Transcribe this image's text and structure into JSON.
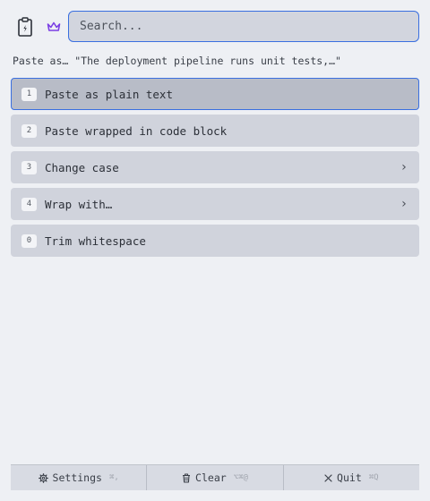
{
  "header": {
    "clipboard_icon": "clipboard-bolt-icon",
    "crown_icon": "crown-icon",
    "accent_color": "#7b3fe4"
  },
  "search": {
    "placeholder": "Search...",
    "value": ""
  },
  "context": {
    "text": "Paste as… \"The deployment pipeline runs unit tests,…\""
  },
  "menu": {
    "items": [
      {
        "key": "1",
        "label": "Paste as plain text",
        "selected": true,
        "submenu": false
      },
      {
        "key": "2",
        "label": "Paste wrapped in code block",
        "selected": false,
        "submenu": false
      },
      {
        "key": "3",
        "label": "Change case",
        "selected": false,
        "submenu": true
      },
      {
        "key": "4",
        "label": "Wrap with…",
        "selected": false,
        "submenu": true
      },
      {
        "key": "0",
        "label": "Trim whitespace",
        "selected": false,
        "submenu": false
      }
    ],
    "submenu_glyph": "›"
  },
  "footer": {
    "settings": {
      "label": "Settings",
      "shortcut": "⌘,",
      "icon": "gear-icon"
    },
    "clear": {
      "label": "Clear",
      "shortcut": "⌥⌘@",
      "icon": "trash-icon"
    },
    "quit": {
      "label": "Quit",
      "shortcut": "⌘Q",
      "icon": "close-icon"
    }
  },
  "colors": {
    "selection_border": "#3a6fe0",
    "background": "#eef0f4"
  }
}
